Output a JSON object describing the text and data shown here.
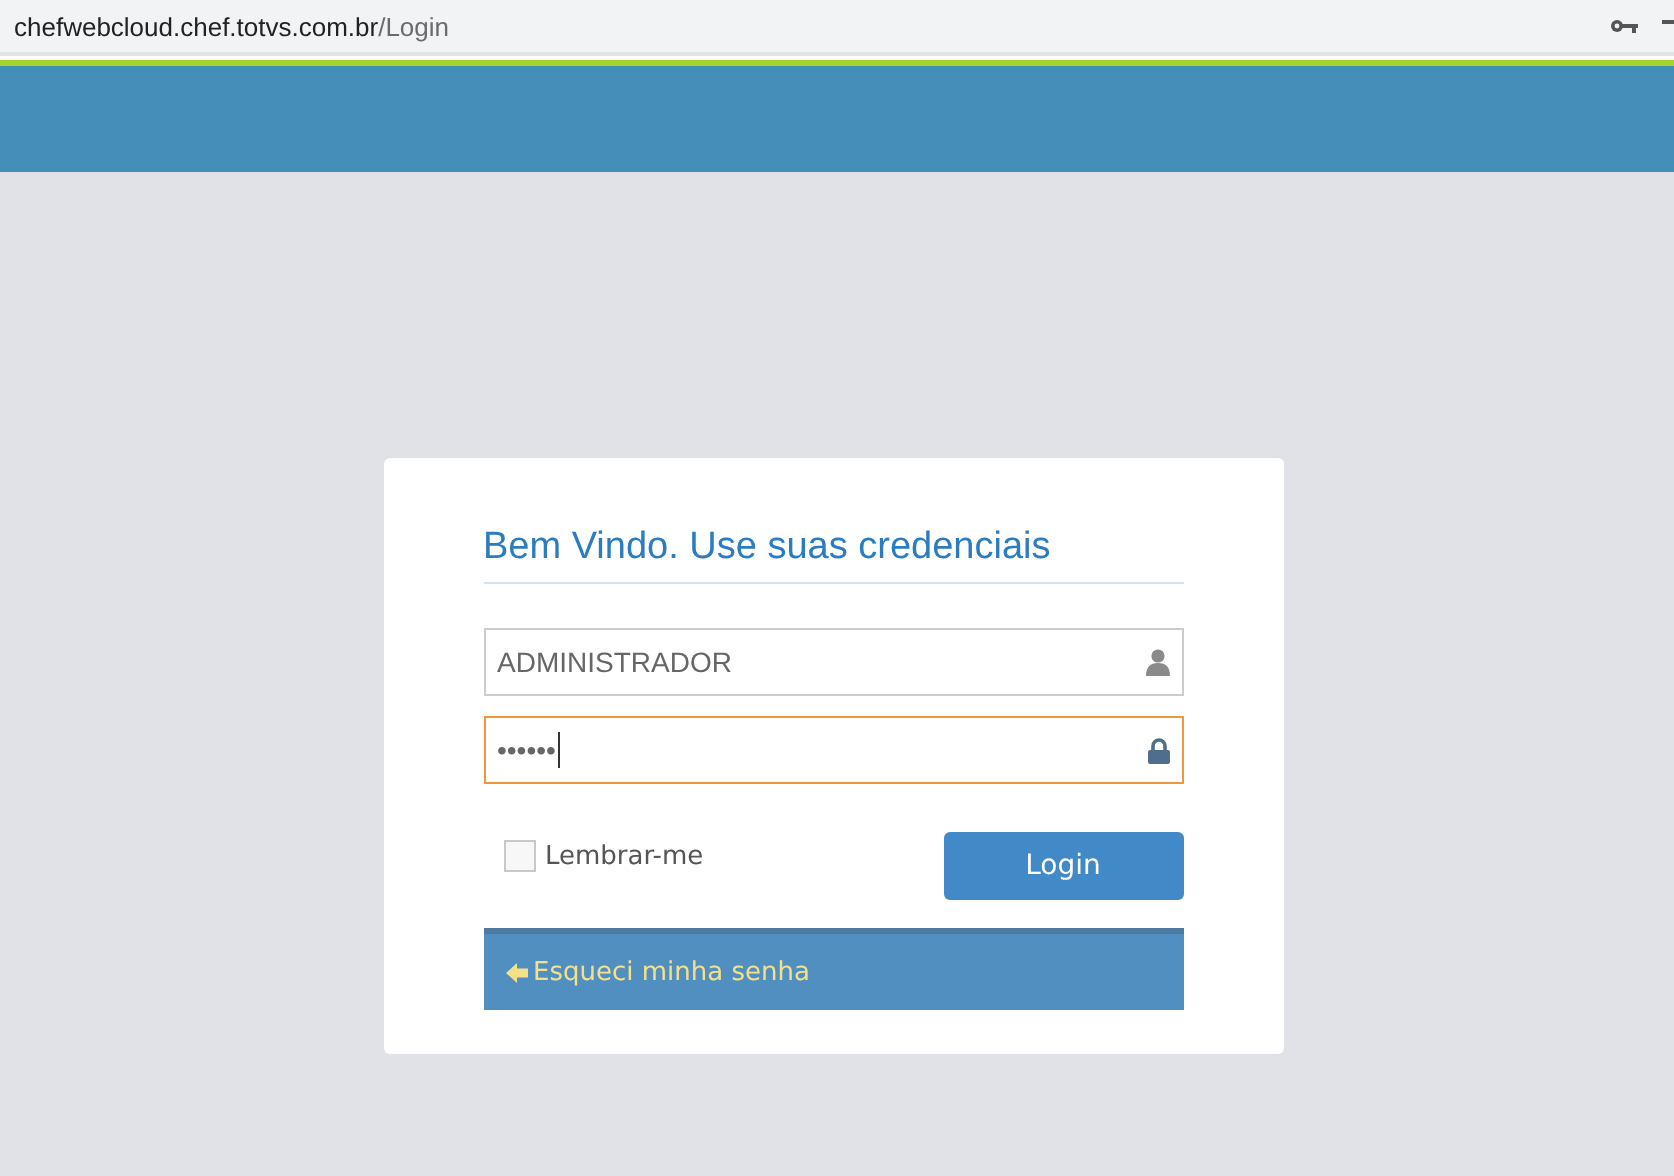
{
  "address_bar": {
    "host": "chefwebcloud.chef.totvs.com.br",
    "path": "/Login"
  },
  "login": {
    "title": "Bem Vindo. Use suas credenciais",
    "fields": [
      {
        "kind": "user",
        "value": "ADMINISTRADOR",
        "focused": false
      },
      {
        "kind": "password",
        "value": "••••••",
        "focused": true
      }
    ],
    "remember": {
      "label": "Lembrar-me",
      "checked": false
    },
    "button": "Login",
    "forgot": "Esqueci minha senha"
  }
}
